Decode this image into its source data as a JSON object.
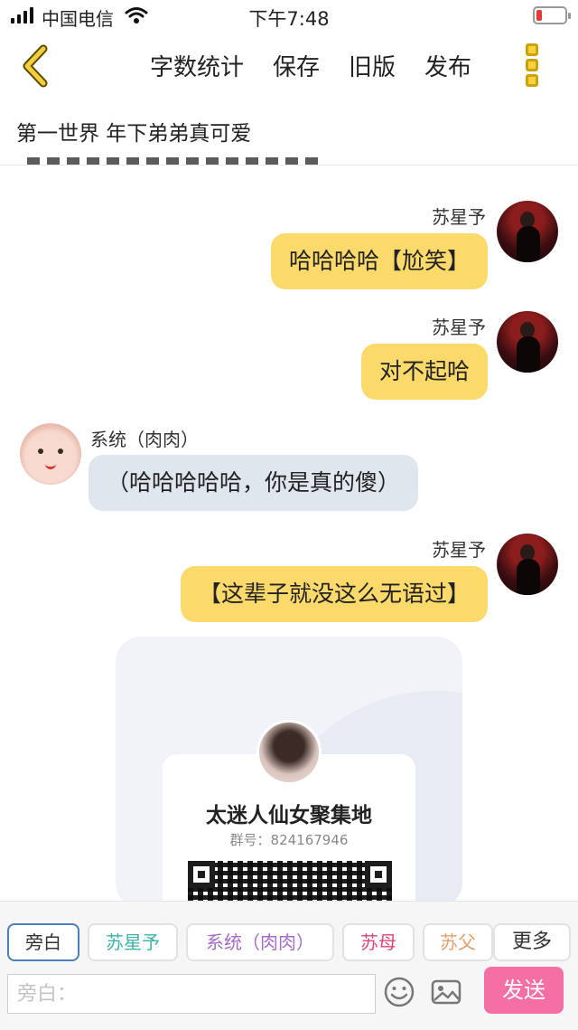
{
  "status": {
    "carrier": "中国电信",
    "time": "下午7:48",
    "battery_level": 0.2
  },
  "nav": {
    "actions": [
      "字数统计",
      "保存",
      "旧版",
      "发布"
    ]
  },
  "subtitle": "第一世界  年下弟弟真可爱",
  "messages": [
    {
      "name": "苏星予",
      "text": "哈哈哈哈【尬笑】"
    },
    {
      "name": "苏星予",
      "text": "对不起哈"
    },
    {
      "name": "系统（肉肉）",
      "text": "（哈哈哈哈哈，你是真的傻）"
    },
    {
      "name": "苏星予",
      "text": "【这辈子就没这么无语过】"
    }
  ],
  "group_card": {
    "name": "太迷人仙女聚集地",
    "number": "群号：824167946"
  },
  "roles": [
    "旁白",
    "苏星予",
    "系统（肉肉）",
    "苏母",
    "苏父",
    "更多"
  ],
  "role_colors": [
    "#333333",
    "#3bb3a8",
    "#a76bc8",
    "#d9457a",
    "#e3a06b",
    "#333333"
  ],
  "input": {
    "placeholder": "旁白："
  },
  "send_label": "发送"
}
